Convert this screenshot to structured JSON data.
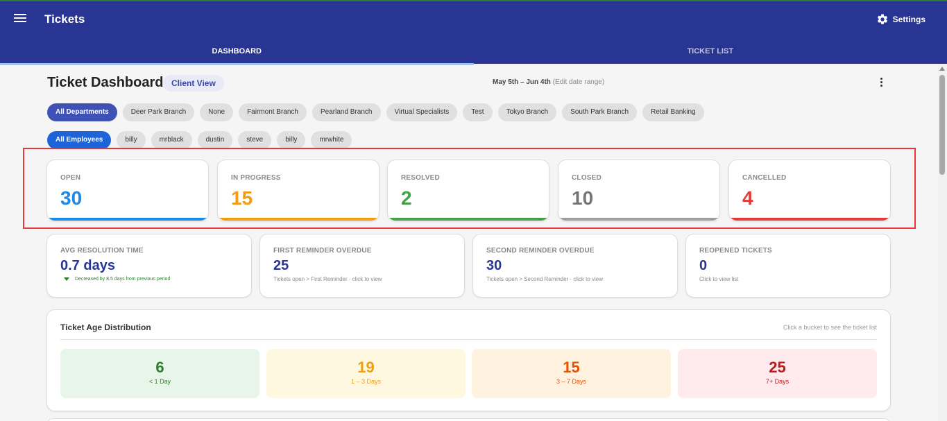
{
  "app": {
    "title": "Tickets",
    "settings_label": "Settings"
  },
  "tabs": [
    {
      "label": "DASHBOARD",
      "active": true
    },
    {
      "label": "TICKET LIST",
      "active": false
    }
  ],
  "header": {
    "title": "Ticket Dashboard",
    "client_view": "Client View",
    "date_range": "May 5th – Jun 4th",
    "edit_date": "(Edit date range)"
  },
  "departments": [
    "All Departments",
    "Deer Park Branch",
    "None",
    "Fairmont Branch",
    "Pearland Branch",
    "Virtual Specialists",
    "Test",
    "Tokyo Branch",
    "South Park Branch",
    "Retail Banking"
  ],
  "employees": [
    "All Employees",
    "billy",
    "mrblack",
    "dustin",
    "steve",
    "billy",
    "mrwhite"
  ],
  "status_cards": [
    {
      "label": "OPEN",
      "value": "30",
      "color": "#1e88e5"
    },
    {
      "label": "IN PROGRESS",
      "value": "15",
      "color": "#f39c12"
    },
    {
      "label": "RESOLVED",
      "value": "2",
      "color": "#43a047"
    },
    {
      "label": "CLOSED",
      "value": "10",
      "color": "#757575"
    },
    {
      "label": "CANCELLED",
      "value": "4",
      "color": "#e53935"
    }
  ],
  "metrics": [
    {
      "label": "AVG RESOLUTION TIME",
      "value": "0.7 days",
      "trend": "Decreased by 8.5 days from previous period"
    },
    {
      "label": "FIRST REMINDER OVERDUE",
      "value": "25",
      "sub": "Tickets open > First Reminder · click to view"
    },
    {
      "label": "SECOND REMINDER OVERDUE",
      "value": "30",
      "sub": "Tickets open > Second Reminder · click to view"
    },
    {
      "label": "REOPENED TICKETS",
      "value": "0",
      "sub": "Click to view list"
    }
  ],
  "age_distribution": {
    "title": "Ticket Age Distribution",
    "hint": "Click a bucket to see the ticket list",
    "buckets": [
      {
        "count": "6",
        "range": "< 1 Day",
        "bg": "#e8f5e9",
        "color": "#2e7d32"
      },
      {
        "count": "19",
        "range": "1 – 3 Days",
        "bg": "#fff8e1",
        "color": "#f39c12"
      },
      {
        "count": "15",
        "range": "3 – 7 Days",
        "bg": "#fff3e0",
        "color": "#e65100"
      },
      {
        "count": "25",
        "range": "7+ Days",
        "bg": "#ffebee",
        "color": "#b71c1c"
      }
    ]
  }
}
